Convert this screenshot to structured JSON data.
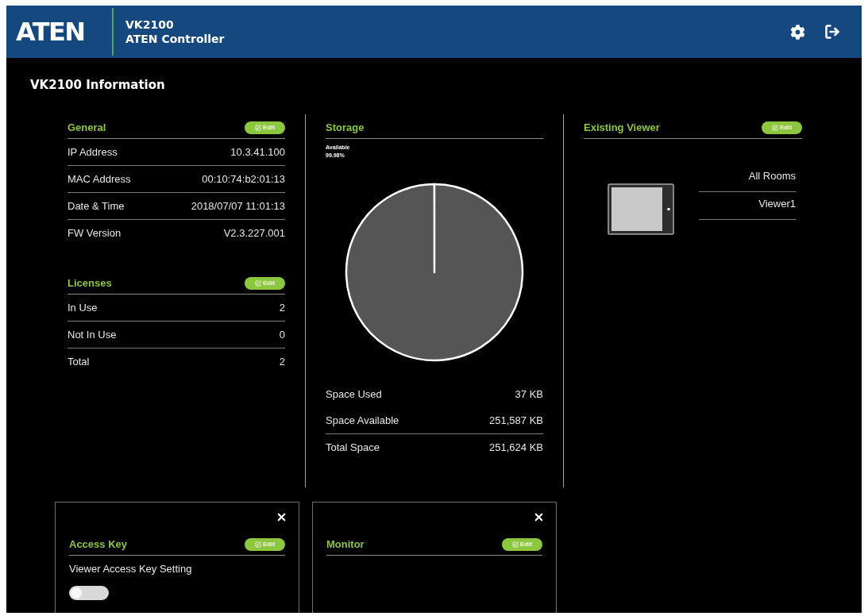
{
  "header": {
    "logo": "ATEN",
    "model": "VK2100",
    "title": "ATEN Controller"
  },
  "page_title": "VK2100 Information",
  "general": {
    "title": "General",
    "edit_label": "Edit",
    "rows": [
      {
        "label": "IP Address",
        "value": "10.3.41.100"
      },
      {
        "label": "MAC Address",
        "value": "00:10:74:b2:01:13"
      },
      {
        "label": "Date & Time",
        "value": "2018/07/07 11:01:13"
      },
      {
        "label": "FW Version",
        "value": "V2.3.227.001"
      }
    ]
  },
  "licenses": {
    "title": "Licenses",
    "edit_label": "Edit",
    "rows": [
      {
        "label": "In Use",
        "value": "2"
      },
      {
        "label": "Not In Use",
        "value": "0"
      },
      {
        "label": "Total",
        "value": "2"
      }
    ]
  },
  "storage": {
    "title": "Storage",
    "chart_data": [
      {
        "type": "pie",
        "categories": [
          "Available"
        ],
        "values": [
          99.98
        ],
        "value_labels": [
          "99.98%"
        ],
        "color": "#555555"
      }
    ],
    "rows": [
      {
        "label": "Space Used",
        "value": "37 KB"
      },
      {
        "label": "Space Available",
        "value": "251,587 KB"
      }
    ],
    "total": {
      "label": "Total Space",
      "value": "251,624 KB"
    }
  },
  "existing_viewer": {
    "title": "Existing Viewer",
    "edit_label": "Edit",
    "items": [
      "All Rooms",
      "Viewer1"
    ]
  },
  "panels": [
    {
      "title": "Access Key",
      "edit_label": "Edit",
      "settings": [
        {
          "kind": "toggle",
          "label": "Viewer Access Key Setting",
          "on": false
        }
      ]
    },
    {
      "title": "Monitor",
      "edit_label": "Edit"
    }
  ]
}
